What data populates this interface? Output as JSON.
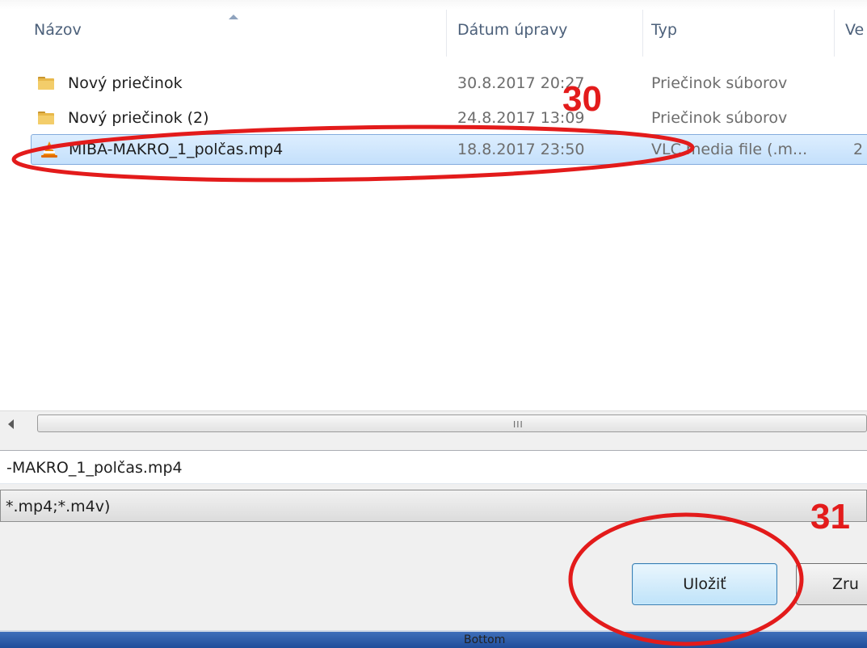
{
  "columns": {
    "name": "Názov",
    "date": "Dátum úpravy",
    "type": "Typ",
    "size": "Ve"
  },
  "files": [
    {
      "name": "Nový priečinok",
      "date": "30.8.2017 20:27",
      "type": "Priečinok súborov",
      "size": "",
      "icon": "folder-icon"
    },
    {
      "name": "Nový priečinok (2)",
      "date": "24.8.2017 13:09",
      "type": "Priečinok súborov",
      "size": "",
      "icon": "folder-icon"
    },
    {
      "name": "MIBA-MAKRO_1_polčas.mp4",
      "date": "18.8.2017 23:50",
      "type": "VLC media file (.m...",
      "size": "2",
      "icon": "vlc-icon",
      "selected": true
    }
  ],
  "scrollbar": {
    "grip": "III"
  },
  "filename_value": "-MAKRO_1_polčas.mp4",
  "filetype_value": "*.mp4;*.m4v)",
  "buttons": {
    "save": "Uložiť",
    "cancel": "Zru"
  },
  "taskbar": {
    "label": "Bottom"
  },
  "annotations": {
    "step_a": "30",
    "step_b": "31"
  },
  "colors": {
    "annotation": "#e31b1b",
    "selection": "#c4e0fc",
    "folder": "#e8b84a"
  }
}
